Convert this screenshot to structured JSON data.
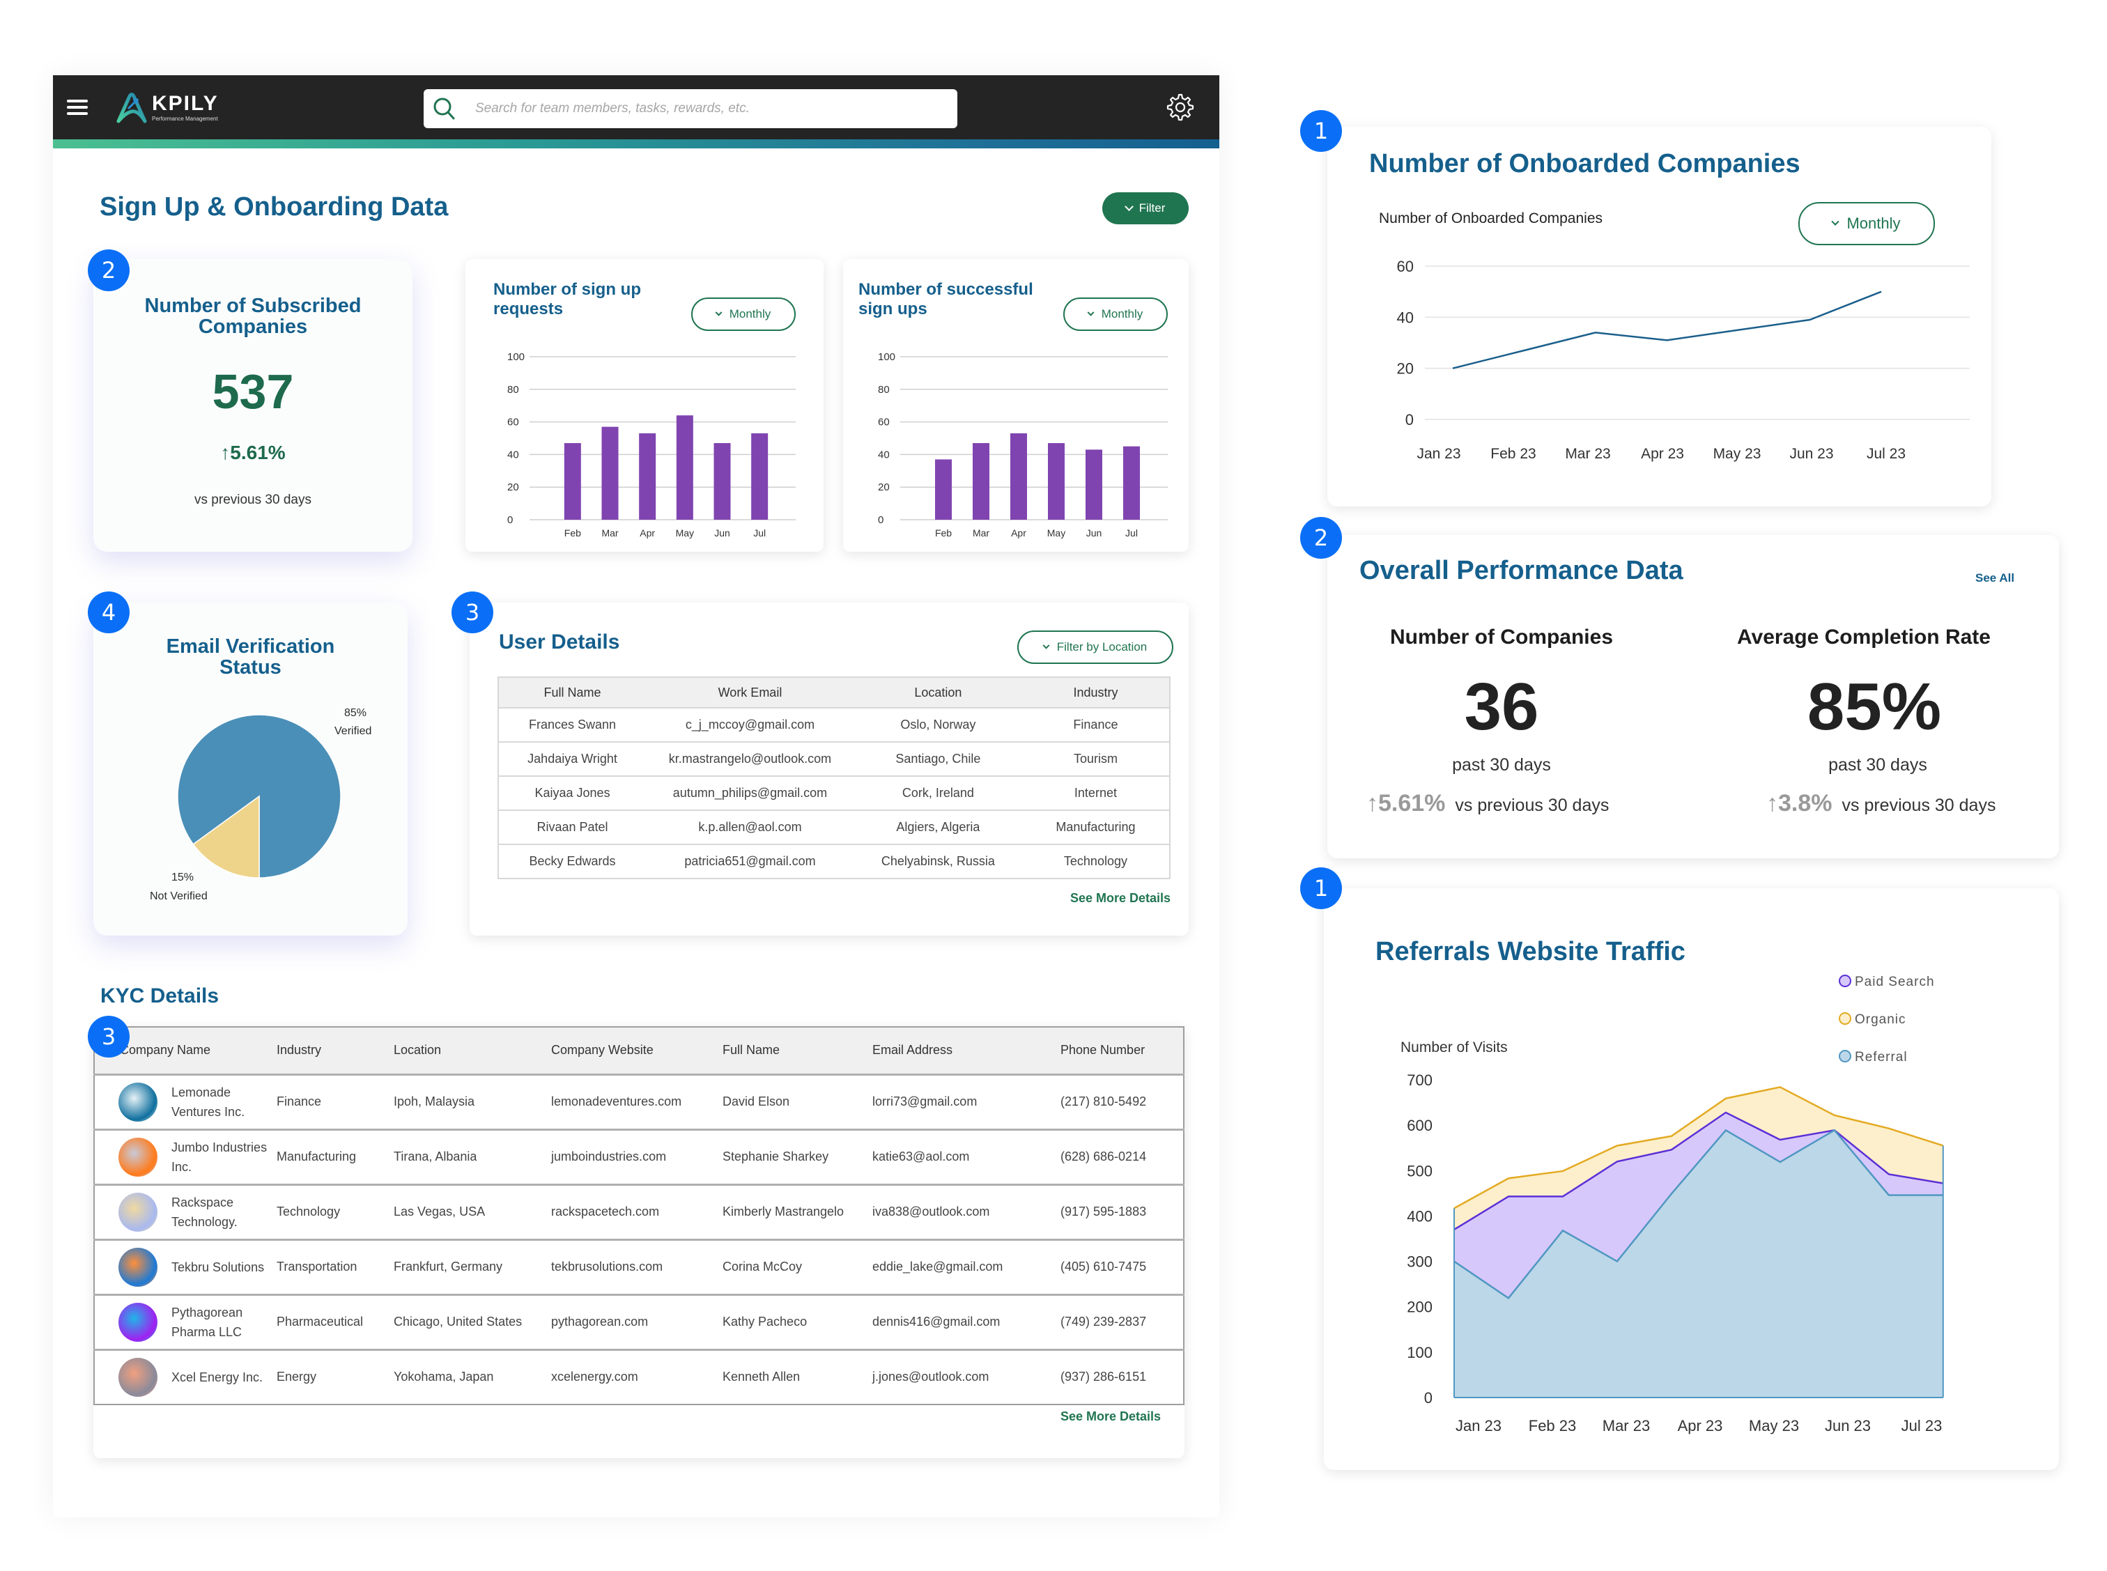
{
  "header": {
    "logo_name": "KPILY",
    "logo_subtitle": "Performance Management",
    "search_placeholder": "Search for team members, tasks, rewards, etc."
  },
  "page": {
    "title": "Sign Up & Onboarding Data",
    "filter_label": "Filter"
  },
  "badges": [
    "2",
    "4",
    "3",
    "3",
    "1",
    "2",
    "1"
  ],
  "subscribed": {
    "title": "Number of Subscribed Companies",
    "value": "537",
    "delta": "↑5.61%",
    "note": "vs previous 30 days"
  },
  "signup_requests": {
    "title_line1": "Number of sign up",
    "title_line2": "requests",
    "period": "Monthly"
  },
  "successful_signups": {
    "title_line1": "Number of successful",
    "title_line2": "sign ups",
    "period": "Monthly"
  },
  "email_verification": {
    "title_line1": "Email Verification",
    "title_line2": "Status",
    "verified_pct": "85%",
    "verified_label": "Verified",
    "not_verified_pct": "15%",
    "not_verified_label": "Not Verified"
  },
  "user_details": {
    "title": "User Details",
    "filter_label": "Filter by Location",
    "columns": [
      "Full Name",
      "Work Email",
      "Location",
      "Industry"
    ],
    "rows": [
      [
        "Frances Swann",
        "c_j_mccoy@gmail.com",
        "Oslo, Norway",
        "Finance"
      ],
      [
        "Jahdaiya Wright",
        "kr.mastrangelo@outlook.com",
        "Santiago, Chile",
        "Tourism"
      ],
      [
        "Kaiyaa Jones",
        "autumn_philips@gmail.com",
        "Cork, Ireland",
        "Internet"
      ],
      [
        "Rivaan Patel",
        "k.p.allen@aol.com",
        "Algiers, Algeria",
        "Manufacturing"
      ],
      [
        "Becky Edwards",
        "patricia651@gmail.com",
        "Chelyabinsk, Russia",
        "Technology"
      ]
    ],
    "see_more": "See More Details"
  },
  "kyc": {
    "title": "KYC Details",
    "columns": [
      "Company Name",
      "Industry",
      "Location",
      "Company Website",
      "Full Name",
      "Email Address",
      "Phone Number"
    ],
    "rows": [
      [
        "Lemonade Ventures Inc.",
        "Finance",
        "Ipoh, Malaysia",
        "lemonadeventures.com",
        "David Elson",
        "lorri73@gmail.com",
        "(217) 810-5492"
      ],
      [
        "Jumbo Industries Inc.",
        "Manufacturing",
        "Tirana, Albania",
        "jumboindustries.com",
        "Stephanie Sharkey",
        "katie63@aol.com",
        "(628) 686-0214"
      ],
      [
        "Rackspace Technology.",
        "Technology",
        "Las Vegas, USA",
        "rackspacetech.com",
        "Kimberly Mastrangelo",
        "iva838@outlook.com",
        "(917) 595-1883"
      ],
      [
        "Tekbru Solutions",
        "Transportation",
        "Frankfurt, Germany",
        "tekbrusolutions.com",
        "Corina McCoy",
        "eddie_lake@gmail.com",
        "(405) 610-7475"
      ],
      [
        "Pythagorean Pharma LLC",
        "Pharmaceutical",
        "Chicago, United States",
        "pythagorean.com",
        "Kathy Pacheco",
        "dennis416@gmail.com",
        "(749) 239-2837"
      ],
      [
        "Xcel Energy Inc.",
        "Energy",
        "Yokohama, Japan",
        "xcelenergy.com",
        "Kenneth Allen",
        "j.jones@outlook.com",
        "(937) 286-6151"
      ]
    ],
    "avatar_colors": [
      [
        "#0f6f9e",
        "#e7f2f7"
      ],
      [
        "#ff7a1a",
        "#c9c9d8"
      ],
      [
        "#a8b9f0",
        "#f0d9a0"
      ],
      [
        "#1d7ad6",
        "#ff8f3a"
      ],
      [
        "#a020f0",
        "#1fb6e8"
      ],
      [
        "#8a8a9a",
        "#f0a080"
      ]
    ],
    "see_more": "See More Details"
  },
  "onboarded": {
    "title": "Number of Onboarded Companies",
    "subtitle": "Number of Onboarded Companies",
    "period": "Monthly"
  },
  "overall": {
    "title": "Overall Performance Data",
    "see_all": "See All",
    "companies_label": "Number of Companies",
    "companies_value": "36",
    "companies_period": "past 30 days",
    "companies_delta": "↑5.61%",
    "companies_delta_note": "vs previous 30 days",
    "completion_label": "Average Completion Rate",
    "completion_value": "85%",
    "completion_period": "past 30 days",
    "completion_delta": "↑3.8%",
    "completion_delta_note": "vs previous 30 days"
  },
  "traffic": {
    "title": "Referrals Website Traffic"
  },
  "colors": {
    "brand_blue": "#155f8c",
    "brand_green": "#207551",
    "bar_purple": "#8044b0",
    "pie_verified": "#4a8fb8",
    "pie_not_verified": "#eed48a",
    "line_blue": "#1a5f8c",
    "badge_blue": "#0a6ff6"
  },
  "chart_data": [
    {
      "type": "bar",
      "title": "Number of sign up requests",
      "categories": [
        "Feb",
        "Mar",
        "Apr",
        "May",
        "Jun",
        "Jul"
      ],
      "values": [
        47,
        57,
        53,
        64,
        47,
        53
      ],
      "ylim": [
        0,
        100
      ],
      "yticks": [
        0,
        20,
        40,
        60,
        80,
        100
      ],
      "xlabel": "",
      "ylabel": "",
      "grid": true
    },
    {
      "type": "bar",
      "title": "Number of successful sign ups",
      "categories": [
        "Feb",
        "Mar",
        "Apr",
        "May",
        "Jun",
        "Jul"
      ],
      "values": [
        37,
        47,
        53,
        47,
        43,
        45
      ],
      "ylim": [
        0,
        100
      ],
      "yticks": [
        0,
        20,
        40,
        60,
        80,
        100
      ],
      "xlabel": "",
      "ylabel": "",
      "grid": true
    },
    {
      "type": "pie",
      "title": "Email Verification Status",
      "labels": [
        "Verified",
        "Not Verified"
      ],
      "values": [
        85,
        15
      ]
    },
    {
      "type": "line",
      "title": "Number of Onboarded Companies",
      "categories": [
        "Jan 23",
        "Feb 23",
        "Mar 23",
        "Apr 23",
        "May 23",
        "Jun 23",
        "Jul 23"
      ],
      "values": [
        20,
        27,
        34,
        31,
        35,
        39,
        50
      ],
      "ylim": [
        0,
        60
      ],
      "yticks": [
        0,
        20,
        40,
        60
      ],
      "ylabel": "Number of Onboarded Companies",
      "grid": true
    },
    {
      "type": "area",
      "title": "Referrals Website Traffic",
      "ylabel": "Number of Visits",
      "x_tick_labels": [
        "Jan 23",
        "Feb 23",
        "Mar 23",
        "Apr 23",
        "May 23",
        "Jun 23",
        "Jul 23"
      ],
      "ylim": [
        0,
        700
      ],
      "yticks": [
        0,
        100,
        200,
        300,
        400,
        500,
        600,
        700
      ],
      "legend": "top-right",
      "series": [
        {
          "name": "Paid Search",
          "values": [
            370,
            443,
            443,
            520,
            546,
            628,
            568,
            589,
            492,
            472
          ]
        },
        {
          "name": "Organic",
          "values": [
            417,
            483,
            499,
            555,
            576,
            659,
            684,
            622,
            593,
            555
          ]
        },
        {
          "name": "Referral",
          "values": [
            300,
            219,
            368,
            300,
            449,
            589,
            519,
            589,
            446,
            446
          ]
        }
      ]
    }
  ]
}
